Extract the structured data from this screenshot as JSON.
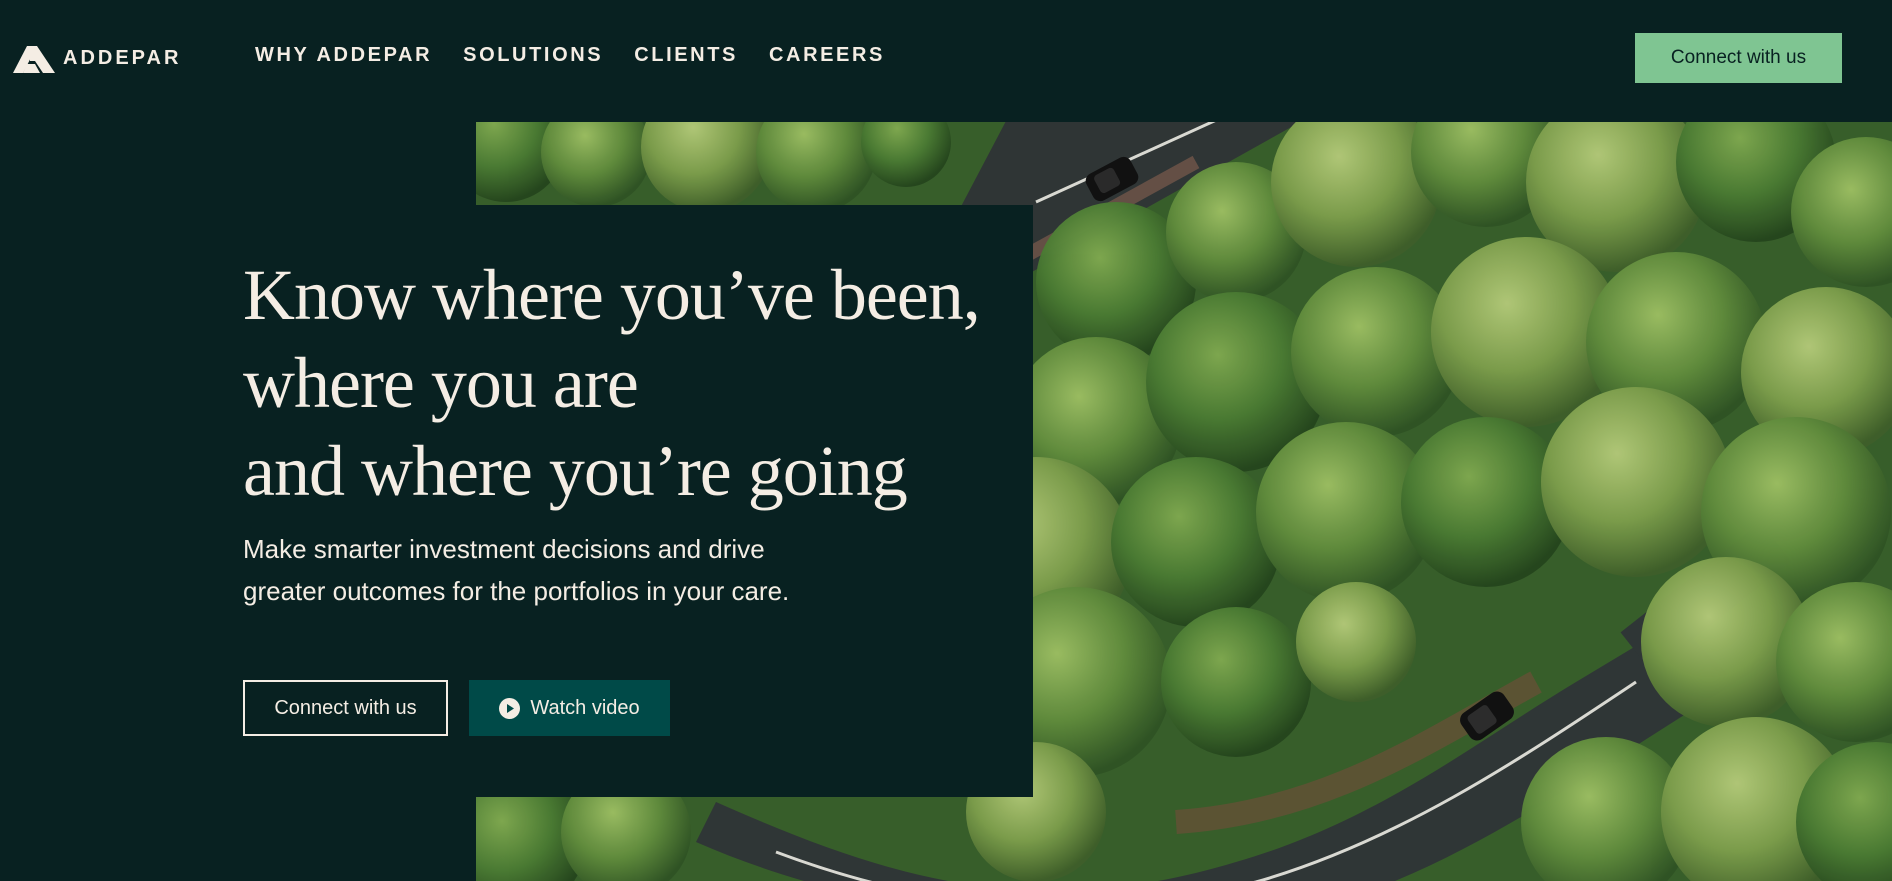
{
  "header": {
    "logo_text": "ADDEPAR",
    "logo_icon": "addepar-logo-mark",
    "nav": [
      {
        "label": "WHY ADDEPAR"
      },
      {
        "label": "SOLUTIONS"
      },
      {
        "label": "CLIENTS"
      },
      {
        "label": "CAREERS"
      }
    ],
    "cta_label": "Connect with us"
  },
  "hero": {
    "title_lines": [
      "Know where you’ve been,",
      "where you are",
      "and where you’re going"
    ],
    "subtitle_lines": [
      "Make smarter investment decisions and drive",
      "greater outcomes for the portfolios in your care."
    ],
    "primary_button_label": "Connect with us",
    "video_button_label": "Watch video",
    "video_button_icon": "play-icon",
    "background_image": "aerial-forest-road-photo"
  },
  "colors": {
    "background": "#082121",
    "text": "#f4ede4",
    "accent_green": "#7fc592",
    "video_button": "#004a48"
  }
}
